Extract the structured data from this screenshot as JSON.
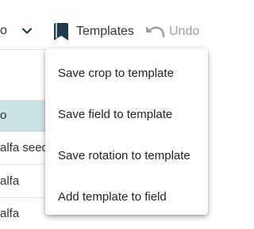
{
  "toolbar": {
    "partial_left_text": "o",
    "templates_label": "Templates",
    "undo_label": "Undo",
    "icons": {
      "dropdown": "chevron-down-icon",
      "templates": "bookmark-icon",
      "undo": "undo-icon"
    }
  },
  "table": {
    "rows": [
      {
        "text": "o",
        "selected": true
      },
      {
        "text": "alfa seed"
      },
      {
        "text": "alfa"
      },
      {
        "text": "alfa"
      }
    ]
  },
  "menu": {
    "items": [
      {
        "label": "Save crop to template"
      },
      {
        "label": "Save field to template"
      },
      {
        "label": "Save rotation to template"
      },
      {
        "label": "Add template to field"
      }
    ]
  },
  "colors": {
    "selected_row": "#c9e2e4",
    "icon": "#1f3a4d",
    "disabled": "#9e9e9e",
    "text": "#212121"
  }
}
